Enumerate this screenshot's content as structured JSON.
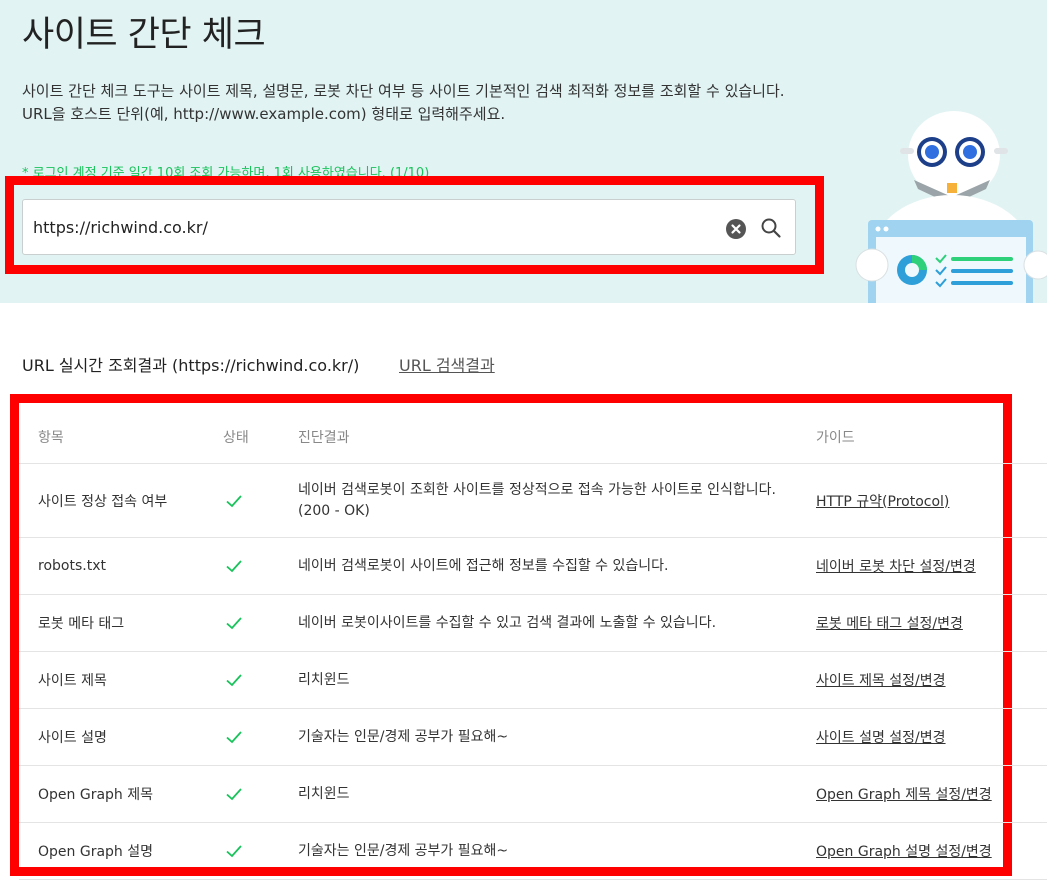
{
  "hero": {
    "title": "사이트 간단 체크",
    "desc_line1": "사이트 간단 체크 도구는 사이트 제목, 설명문, 로봇 차단 여부 등 사이트 기본적인 검색 최적화 정보를 조회할 수 있습니다.",
    "desc_line2": "URL을 호스트 단위(예, http://www.example.com) 형태로 입력해주세요.",
    "notice": "* 로그인 계정 기준 일간 10회 조회 가능하며, 1회 사용하였습니다. (1/10)"
  },
  "search": {
    "value": "https://richwind.co.kr/",
    "clear_icon": "clear-circle-x-icon",
    "search_icon": "magnifier-icon"
  },
  "results": {
    "heading": "URL 실시간 조회결과 (https://richwind.co.kr/)",
    "link": "URL 검색결과",
    "columns": {
      "item": "항목",
      "status": "상태",
      "result": "진단결과",
      "guide": "가이드"
    },
    "rows": [
      {
        "item": "사이트 정상 접속 여부",
        "status": "check-icon",
        "result": "네이버 검색로봇이 조회한 사이트를 정상적으로 접속 가능한 사이트로 인식합니다. (200 - OK)",
        "guide": "HTTP 규약(Protocol)"
      },
      {
        "item": "robots.txt",
        "status": "check-icon",
        "result": "네이버 검색로봇이 사이트에 접근해 정보를 수집할 수 있습니다.",
        "guide": "네이버 로봇 차단 설정/변경"
      },
      {
        "item": "로봇 메타 태그",
        "status": "check-icon",
        "result": "네이버 로봇이사이트를 수집할 수 있고 검색 결과에 노출할 수 있습니다.",
        "guide": "로봇 메타 태그 설정/변경"
      },
      {
        "item": "사이트 제목",
        "status": "check-icon",
        "result": "리치윈드",
        "guide": "사이트 제목 설정/변경"
      },
      {
        "item": "사이트 설명",
        "status": "check-icon",
        "result": "기술자는 인문/경제 공부가 필요해~",
        "guide": "사이트 설명 설정/변경"
      },
      {
        "item": "Open Graph 제목",
        "status": "check-icon",
        "result": "리치윈드",
        "guide": "Open Graph 제목 설정/변경"
      },
      {
        "item": "Open Graph 설명",
        "status": "check-icon",
        "result": "기술자는 인문/경제 공부가 필요해~",
        "guide": "Open Graph 설명 설정/변경"
      }
    ]
  },
  "colors": {
    "hero_bg": "#e2f3f3",
    "notice_green": "#19c25b",
    "check_green": "#19c25b",
    "highlight_red": "#ff0000"
  }
}
